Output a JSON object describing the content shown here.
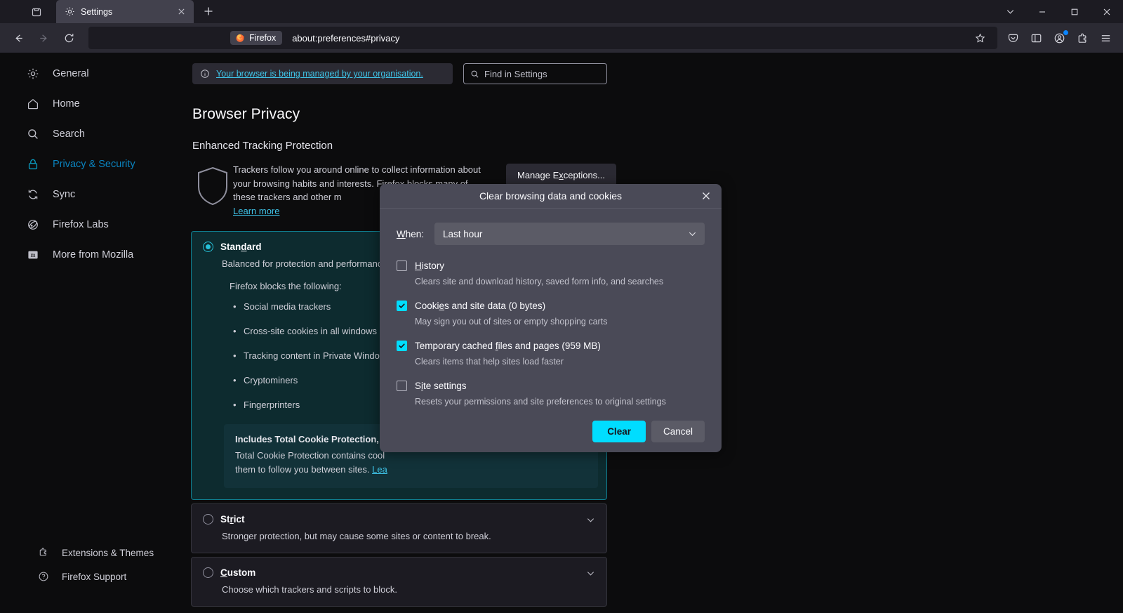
{
  "window": {
    "tab": {
      "title": "Settings",
      "icon": "gear-icon"
    },
    "controls": {
      "minimize": "–",
      "maximize": "□",
      "close": "✕",
      "list_all_tabs": "⌄"
    }
  },
  "urlbar": {
    "chip_label": "Firefox",
    "url": "about:preferences#privacy"
  },
  "sidebar": {
    "items": [
      {
        "label": "General",
        "icon": "gear-icon",
        "active": false
      },
      {
        "label": "Home",
        "icon": "home-icon",
        "active": false
      },
      {
        "label": "Search",
        "icon": "search-icon",
        "active": false
      },
      {
        "label": "Privacy & Security",
        "icon": "lock-icon",
        "active": true
      },
      {
        "label": "Sync",
        "icon": "sync-icon",
        "active": false
      },
      {
        "label": "Firefox Labs",
        "icon": "flask-atom-icon",
        "active": false
      },
      {
        "label": "More from Mozilla",
        "icon": "mozilla-m-icon",
        "active": false
      }
    ],
    "bottom_items": [
      {
        "label": "Extensions & Themes",
        "icon": "puzzle-icon"
      },
      {
        "label": "Firefox Support",
        "icon": "question-circle-icon"
      }
    ]
  },
  "main": {
    "managed_notice": "Your browser is being managed by your organisation.",
    "search_placeholder": "Find in Settings",
    "page_title": "Browser Privacy",
    "section_title": "Enhanced Tracking Protection",
    "etp_description": "Trackers follow you around online to collect information about your browsing habits and interests. Firefox blocks many of these trackers and other m",
    "etp_learn_more": "Learn more",
    "manage_exceptions_label": "Manage Exceptions...",
    "options": [
      {
        "name": "Standard",
        "name_pre": "Stan",
        "name_accel": "d",
        "name_post": "ard",
        "selected": true,
        "description": "Balanced for protection and performanc",
        "blocks_label": "Firefox blocks the following:",
        "blocks": [
          "Social media trackers",
          "Cross-site cookies in all windows",
          "Tracking content in Private Windows",
          "Cryptominers",
          "Fingerprinters"
        ],
        "callout_title": "Includes Total Cookie Protection, ou",
        "callout_body_1": "Total Cookie Protection contains cool",
        "callout_body_2": "them to follow you between sites. ",
        "callout_link": "Lea"
      },
      {
        "name": "Strict",
        "name_pre": "St",
        "name_accel": "r",
        "name_post": "ict",
        "selected": false,
        "description": "Stronger protection, but may cause some sites or content to break."
      },
      {
        "name": "Custom",
        "name_pre": "",
        "name_accel": "C",
        "name_post": "ustom",
        "selected": false,
        "description": "Choose which trackers and scripts to block."
      }
    ]
  },
  "dialog": {
    "title": "Clear browsing data and cookies",
    "close_icon": "close-icon",
    "when_label_accel": "W",
    "when_label_rest": "hen:",
    "when_value": "Last hour",
    "items": [
      {
        "label_pre": "H",
        "label_post": "istory",
        "accel_at_start": true,
        "label": "History",
        "checked": false,
        "description": "Clears site and download history, saved form info, and searches"
      },
      {
        "label_pre": "Cooki",
        "label_accel": "e",
        "label_post": "s and site data (0 bytes)",
        "label": "Cookies and site data (0 bytes)",
        "checked": true,
        "description": "May sign you out of sites or empty shopping carts"
      },
      {
        "label_pre": "Temporary cached ",
        "label_accel": "f",
        "label_post": "iles and pages (959 MB)",
        "label": "Temporary cached files and pages (959 MB)",
        "checked": true,
        "description": "Clears items that help sites load faster"
      },
      {
        "label_pre": "S",
        "label_accel": "i",
        "label_post": "te settings",
        "label": "Site settings",
        "checked": false,
        "description": "Resets your permissions and site preferences to original settings"
      }
    ],
    "clear_label": "Clear",
    "cancel_label": "Cancel"
  },
  "colors": {
    "accent": "#00ddff",
    "link": "#3fc4e8",
    "selected_card_bg": "#0d2b2f",
    "selected_card_border": "#0f7f91",
    "dialog_bg": "#4a4a57",
    "chrome_bg": "#2b2a33",
    "page_bg": "#0c0c0d"
  }
}
